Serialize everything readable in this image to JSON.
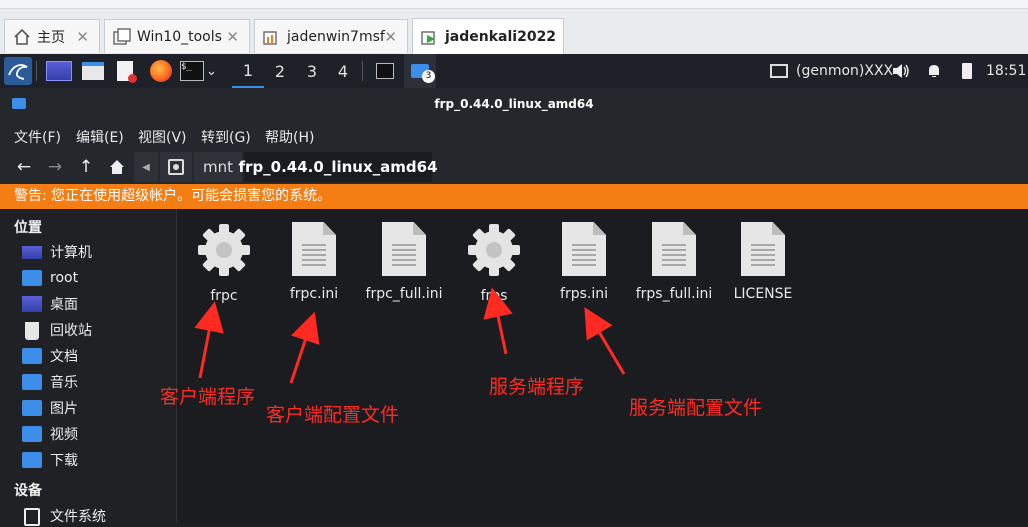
{
  "vm_tabs": [
    {
      "label": "主页"
    },
    {
      "label": "Win10_tools"
    },
    {
      "label": "jadenwin7msf"
    },
    {
      "label": "jadenkali2022"
    }
  ],
  "panel": {
    "workspaces": [
      "1",
      "2",
      "3",
      "4"
    ],
    "badge": "3",
    "genmon": "(genmon)XXX",
    "clock": "18:51"
  },
  "window": {
    "title": "frp_0.44.0_linux_amd64",
    "menu": [
      "文件(F)",
      "编辑(E)",
      "视图(V)",
      "转到(G)",
      "帮助(H)"
    ],
    "crumbs": [
      "mnt",
      "frp_0.44.0_linux_amd64"
    ],
    "warning": "警告: 您正在使用超级帐户。可能会损害您的系统。"
  },
  "sidebar": {
    "places_title": "位置",
    "places": [
      "计算机",
      "root",
      "桌面",
      "回收站",
      "文档",
      "音乐",
      "图片",
      "视频",
      "下载"
    ],
    "devices_title": "设备",
    "devices": [
      "文件系统"
    ]
  },
  "files": [
    {
      "name": "frpc",
      "icon": "gear-icon"
    },
    {
      "name": "frpc.ini",
      "icon": "text-file-icon"
    },
    {
      "name": "frpc_full.ini",
      "icon": "text-file-icon"
    },
    {
      "name": "frps",
      "icon": "gear-icon"
    },
    {
      "name": "frps.ini",
      "icon": "text-file-icon"
    },
    {
      "name": "frps_full.ini",
      "icon": "text-file-icon"
    },
    {
      "name": "LICENSE",
      "icon": "text-file-icon"
    }
  ],
  "annotations": [
    "客户端程序",
    "客户端配置文件",
    "服务端程序",
    "服务端配置文件"
  ],
  "colors": {
    "warning": "#f47e13",
    "accent": "#3d8ee8",
    "annotation": "#ff2a22"
  }
}
